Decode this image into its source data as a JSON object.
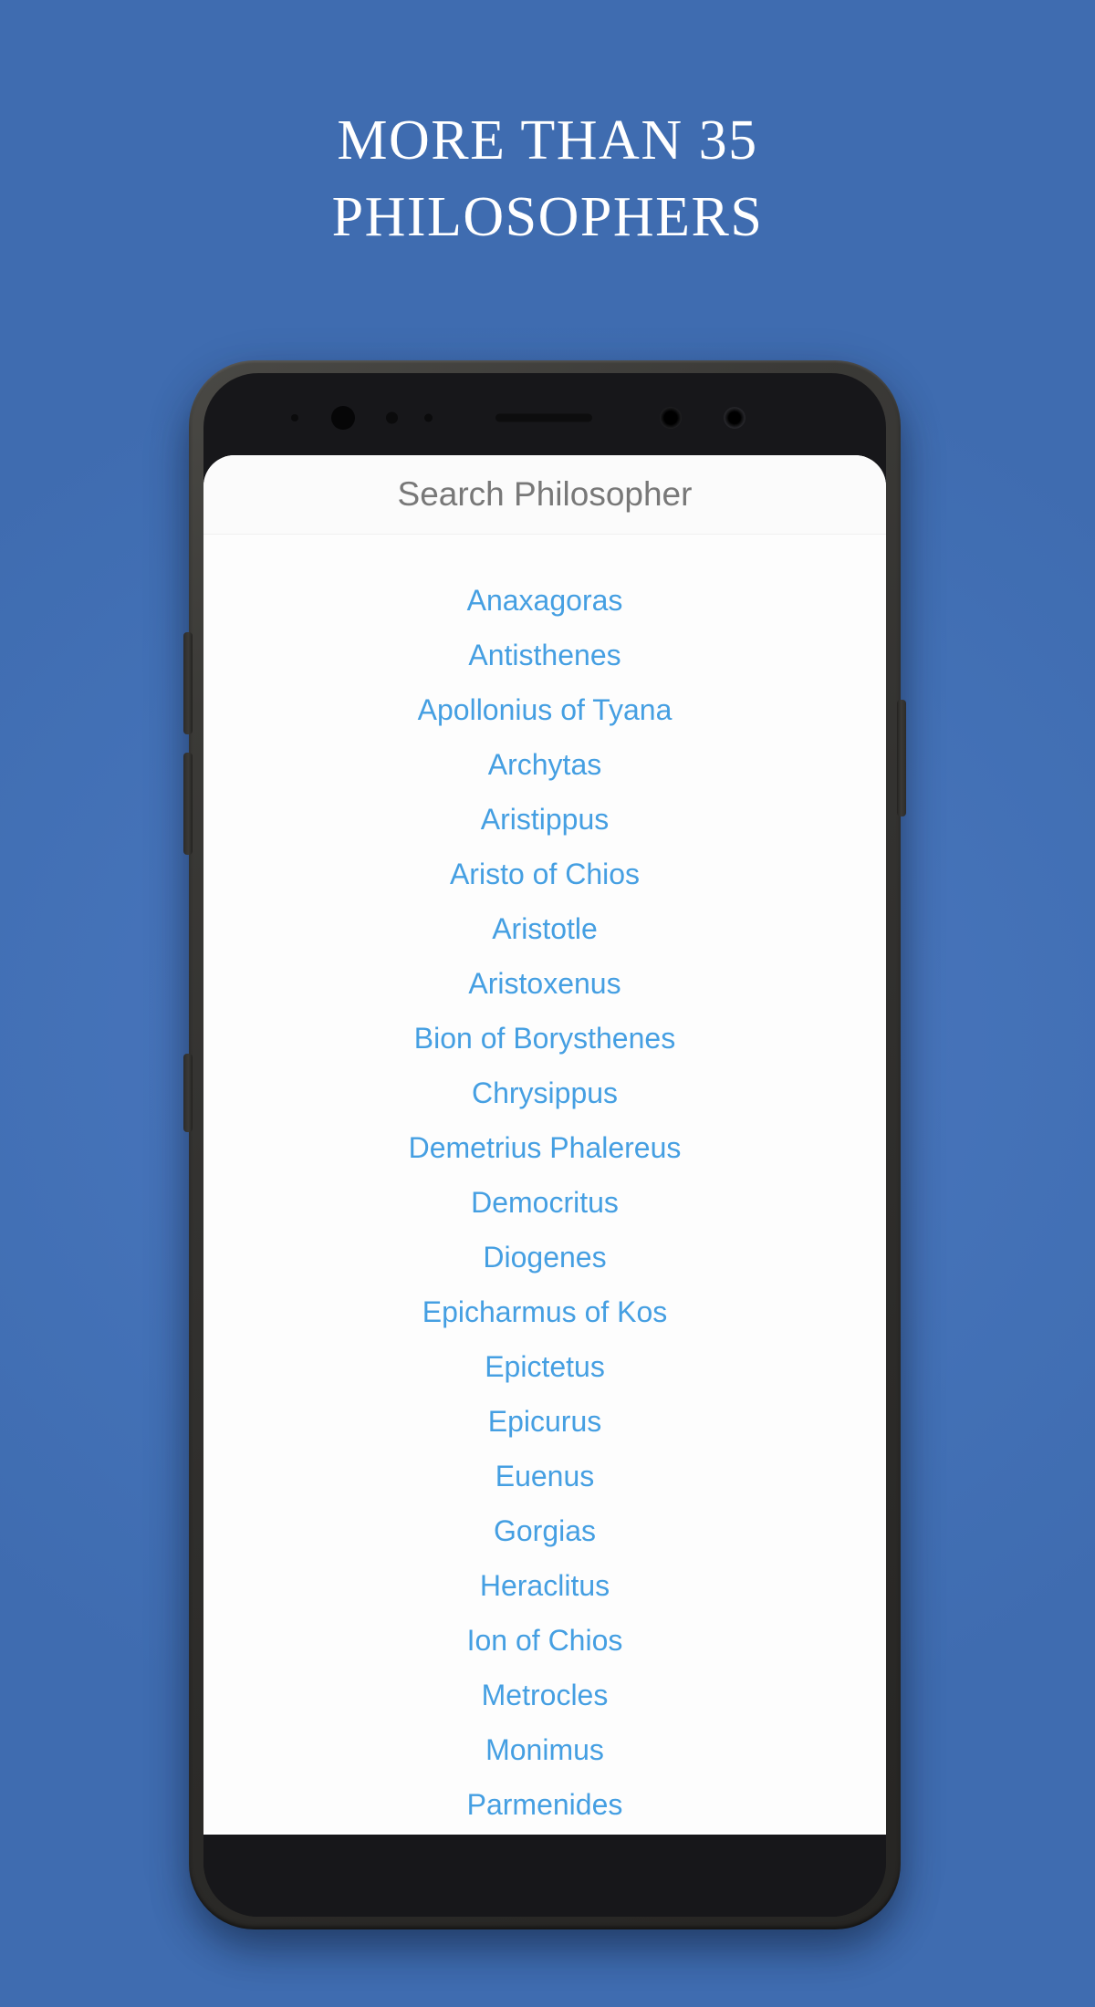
{
  "page": {
    "background_color": "#4472b8",
    "headline": "More than 35\nPhilosophers"
  },
  "device": {
    "frame_color": "#2e2d2b",
    "bezel_color": "#17171a",
    "sensors": [
      "proximity-sensor-dot",
      "front-camera-lens",
      "iris-sensor-dot",
      "light-sensor-dot",
      "earpiece-speaker",
      "camera-lens-secondary",
      "camera-lens-tertiary"
    ],
    "buttons": [
      "volume-up",
      "volume-down",
      "bixby",
      "power"
    ]
  },
  "app": {
    "search": {
      "placeholder": "Search Philosopher",
      "value": ""
    },
    "list": {
      "text_color": "#459fe2",
      "items": [
        "Anaxagoras",
        "Antisthenes",
        "Apollonius of Tyana",
        "Archytas",
        "Aristippus",
        "Aristo of Chios",
        "Aristotle",
        "Aristoxenus",
        "Bion of Borysthenes",
        "Chrysippus",
        "Demetrius Phalereus",
        "Democritus",
        "Diogenes",
        "Epicharmus of Kos",
        "Epictetus",
        "Epicurus",
        "Euenus",
        "Gorgias",
        "Heraclitus",
        "Ion of Chios",
        "Metrocles",
        "Monimus",
        "Parmenides"
      ]
    }
  }
}
